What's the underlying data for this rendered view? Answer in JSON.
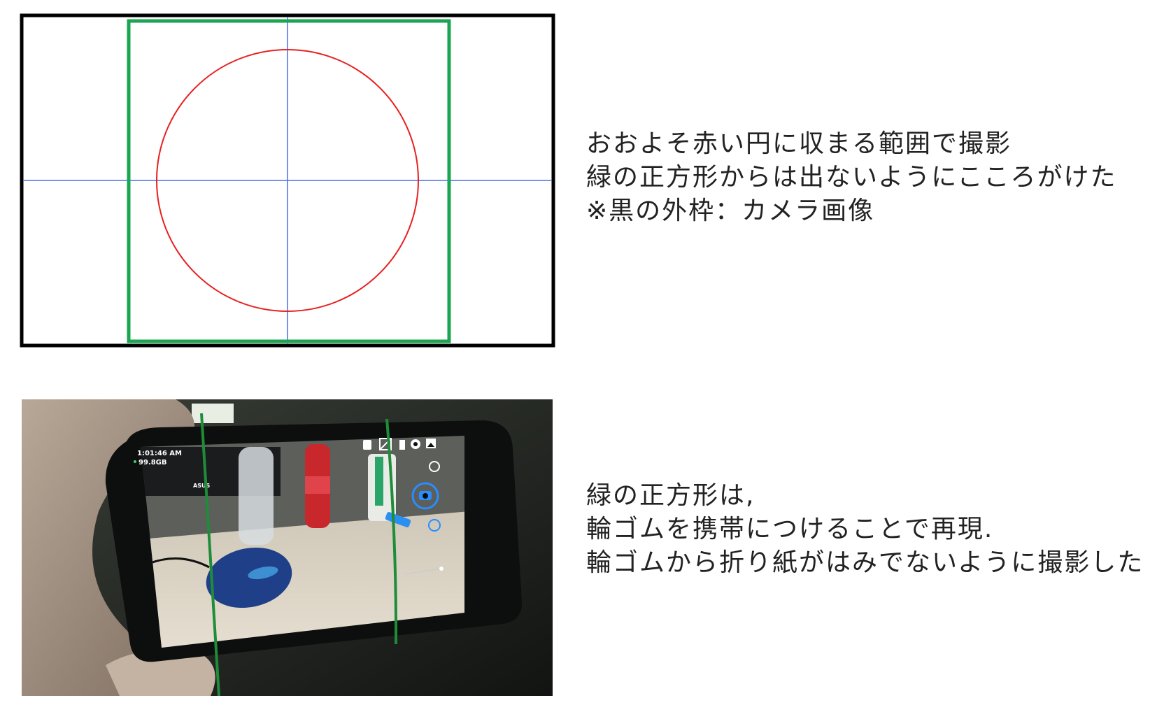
{
  "diagram": {
    "frame_label": "",
    "colors": {
      "outer_frame": "#000000",
      "square": "#1aa650",
      "circle": "#e82020",
      "crosshair": "#4a6fe0"
    }
  },
  "caption_top": {
    "lines": [
      "おおよそ赤い円に収まる範囲で撮影",
      "緑の正方形からは出ないようにこころがけた",
      "※黒の外枠：カメラ画像"
    ]
  },
  "photo": {
    "screen": {
      "time": "1:01:46 AM",
      "storage": "99.8GB",
      "monitor_brand": "ASUS"
    },
    "icons": [
      "pointer-icon",
      "exposure-icon",
      "timer-icon",
      "settings-icon",
      "gallery-icon",
      "camera-switch-icon",
      "shutter-icon",
      "video-icon"
    ],
    "colors": {
      "rubber_band": "#1f8c3a",
      "phone_body": "#0d0f0e",
      "shutter": "#2a8cff"
    }
  },
  "caption_bottom": {
    "lines": [
      "緑の正方形は,",
      "輪ゴムを携帯につけることで再現.",
      "輪ゴムから折り紙がはみでないように撮影した"
    ]
  }
}
